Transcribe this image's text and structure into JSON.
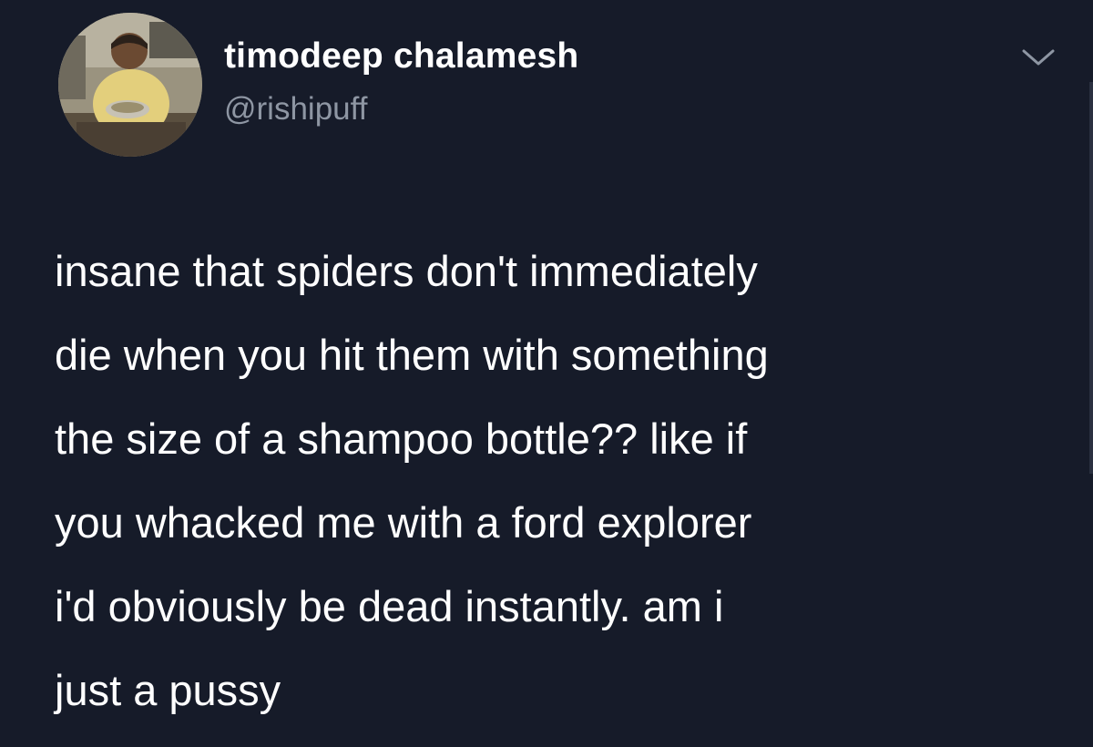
{
  "tweet": {
    "author": {
      "display_name": "timodeep chalamesh",
      "handle": "@rishipuff",
      "avatar_icon": "profile-photo"
    },
    "menu_icon": "chevron-down-icon",
    "text_lines": [
      "insane that spiders don't immediately",
      "die when you hit them with something",
      "the size of a shampoo bottle?? like if",
      "you whacked me with a ford explorer",
      "i'd obviously be dead instantly. am i",
      "just a pussy"
    ]
  },
  "colors": {
    "background": "#161b29",
    "primary_text": "#ffffff",
    "secondary_text": "#8e96a3"
  }
}
